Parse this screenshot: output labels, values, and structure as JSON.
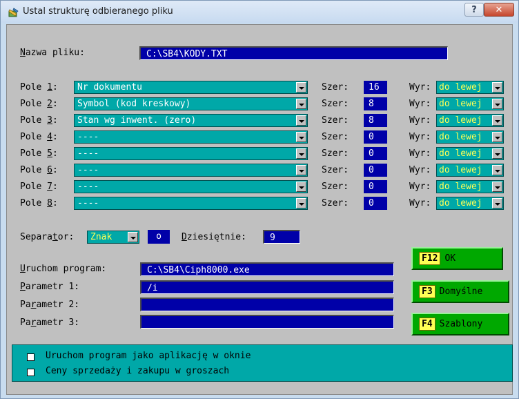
{
  "window": {
    "title": "Ustal strukturę odbieranego pliku"
  },
  "file": {
    "label_u": "N",
    "label_rest": "azwa pliku:",
    "value": "C:\\SB4\\KODY.TXT"
  },
  "fields": [
    {
      "label": "Pole ",
      "num": "1",
      "value": "Nr dokumentu",
      "szer": "16",
      "wyr": "do lewej"
    },
    {
      "label": "Pole ",
      "num": "2",
      "value": "Symbol (kod kreskowy)",
      "szer": "8",
      "wyr": "do lewej"
    },
    {
      "label": "Pole ",
      "num": "3",
      "value": "Stan wg inwent. (zero)",
      "szer": "8",
      "wyr": "do lewej"
    },
    {
      "label": "Pole ",
      "num": "4",
      "value": "----",
      "szer": "0",
      "wyr": "do lewej"
    },
    {
      "label": "Pole ",
      "num": "5",
      "value": "----",
      "szer": "0",
      "wyr": "do lewej"
    },
    {
      "label": "Pole ",
      "num": "6",
      "value": "----",
      "szer": "0",
      "wyr": "do lewej"
    },
    {
      "label": "Pole ",
      "num": "7",
      "value": "----",
      "szer": "0",
      "wyr": "do lewej"
    },
    {
      "label": "Pole ",
      "num": "8",
      "value": "----",
      "szer": "0",
      "wyr": "do lewej"
    }
  ],
  "szer_label": "Szer:",
  "wyr_label": "Wyr:",
  "separator": {
    "l1": "Separa",
    "u": "t",
    "l2": "or:",
    "value": "Znak",
    "char": "o"
  },
  "dziesietnie": {
    "u": "D",
    "rest": "ziesiętnie:",
    "value": "9"
  },
  "program": {
    "run_u": "U",
    "run_rest": "ruchom program:",
    "run_value": "C:\\SB4\\Ciph8000.exe",
    "p1_u": "P",
    "p1_rest": "arametr 1:",
    "p1_value": "/i",
    "p2_a": "Pa",
    "p2_u": "r",
    "p2_rest": "ametr 2:",
    "p2_value": "",
    "p3_a": "Pa",
    "p3_u": "r",
    "p3_rest": "ametr 3:",
    "p3_value": ""
  },
  "buttons": {
    "ok_key": "F12",
    "ok_label": "OK",
    "def_key": "F3",
    "def_label": "Domyślne",
    "tpl_key": "F4",
    "tpl_label": "Szablony"
  },
  "options": [
    {
      "label": "Uruchom program jako aplikację w oknie"
    },
    {
      "label": "Ceny sprzedaży i zakupu w groszach"
    }
  ],
  "colors": {
    "field_blue": "#0000a8",
    "combo_cyan": "#00a8a8",
    "button_green": "#00a800",
    "key_yellow": "#ffff55"
  }
}
